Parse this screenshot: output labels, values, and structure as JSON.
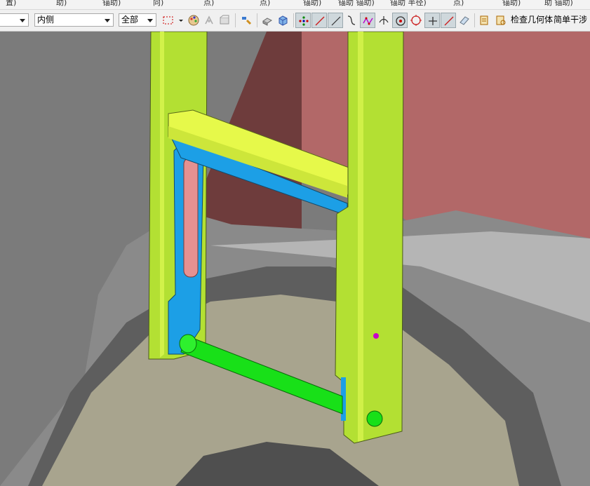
{
  "top_strip": [
    "置)",
    "助)",
    "锚助)",
    "向)",
    "点)",
    "点)",
    "锚助)",
    "锚助 锚助)",
    "锚助 半径)",
    "点)",
    "锚助)",
    "助 锚助)"
  ],
  "toolbar": {
    "filter_left_value": "",
    "filter_side_value": "内侧",
    "filter_scope_value": "全部",
    "check_geometry_label": "检查几何体",
    "simple_interference_label": "简单干涉",
    "icons": [
      "select-box-icon",
      "dropdown-icon",
      "palette-icon",
      "snap-icon",
      "component-icon",
      "tools-icon",
      "solid-icon",
      "block-icon",
      "points-icon",
      "line-icon",
      "line-icon",
      "curve-icon",
      "polyline-icon",
      "intersection-icon",
      "circle-center-icon",
      "circle-icon",
      "plus-icon",
      "slash-icon",
      "section-icon",
      "check-geometry-icon",
      "interference-icon"
    ]
  },
  "colors": {
    "frame_yellow": "#b5e133",
    "crossbar_yellow": "#e5f84a",
    "link_blue": "#1aa0e8",
    "rod_green": "#19e619",
    "slot_pink": "#e89090",
    "background_red": "#b06666",
    "floor_beige": "#a9a58d",
    "pin_magenta": "#c800c8"
  },
  "viewport": {
    "scene": "3d-cad-model"
  }
}
